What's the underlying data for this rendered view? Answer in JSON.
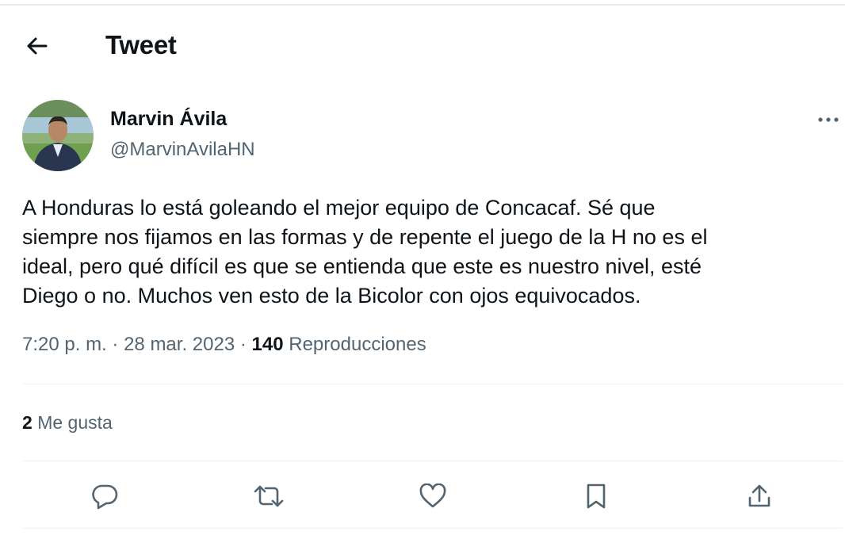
{
  "header": {
    "title": "Tweet"
  },
  "tweet": {
    "author_name": "Marvin Ávila",
    "author_handle": "@MarvinAvilaHN",
    "text_lines": [
      "A Honduras lo está goleando el mejor equipo de Concacaf. Sé que",
      "siempre nos fijamos en las formas y de repente el juego de la H no es el",
      "ideal, pero qué difícil es que se entienda que este es nuestro nivel, esté",
      "Diego o no. Muchos ven esto de la Bicolor con ojos equivocados."
    ],
    "time": "7:20 p. m.",
    "separator": "·",
    "date": "28 mar. 2023",
    "views_count": "140",
    "views_label": "Reproducciones"
  },
  "stats": {
    "likes_count": "2",
    "likes_label": "Me gusta"
  },
  "icons": {
    "back": "arrow-left-icon",
    "more": "more-horizontal-icon",
    "reply": "reply-icon",
    "retweet": "retweet-icon",
    "like": "heart-icon",
    "bookmark": "bookmark-icon",
    "share": "share-icon"
  },
  "colors": {
    "text_primary": "#0f1419",
    "text_secondary": "#536471",
    "divider": "#eff3f4"
  }
}
